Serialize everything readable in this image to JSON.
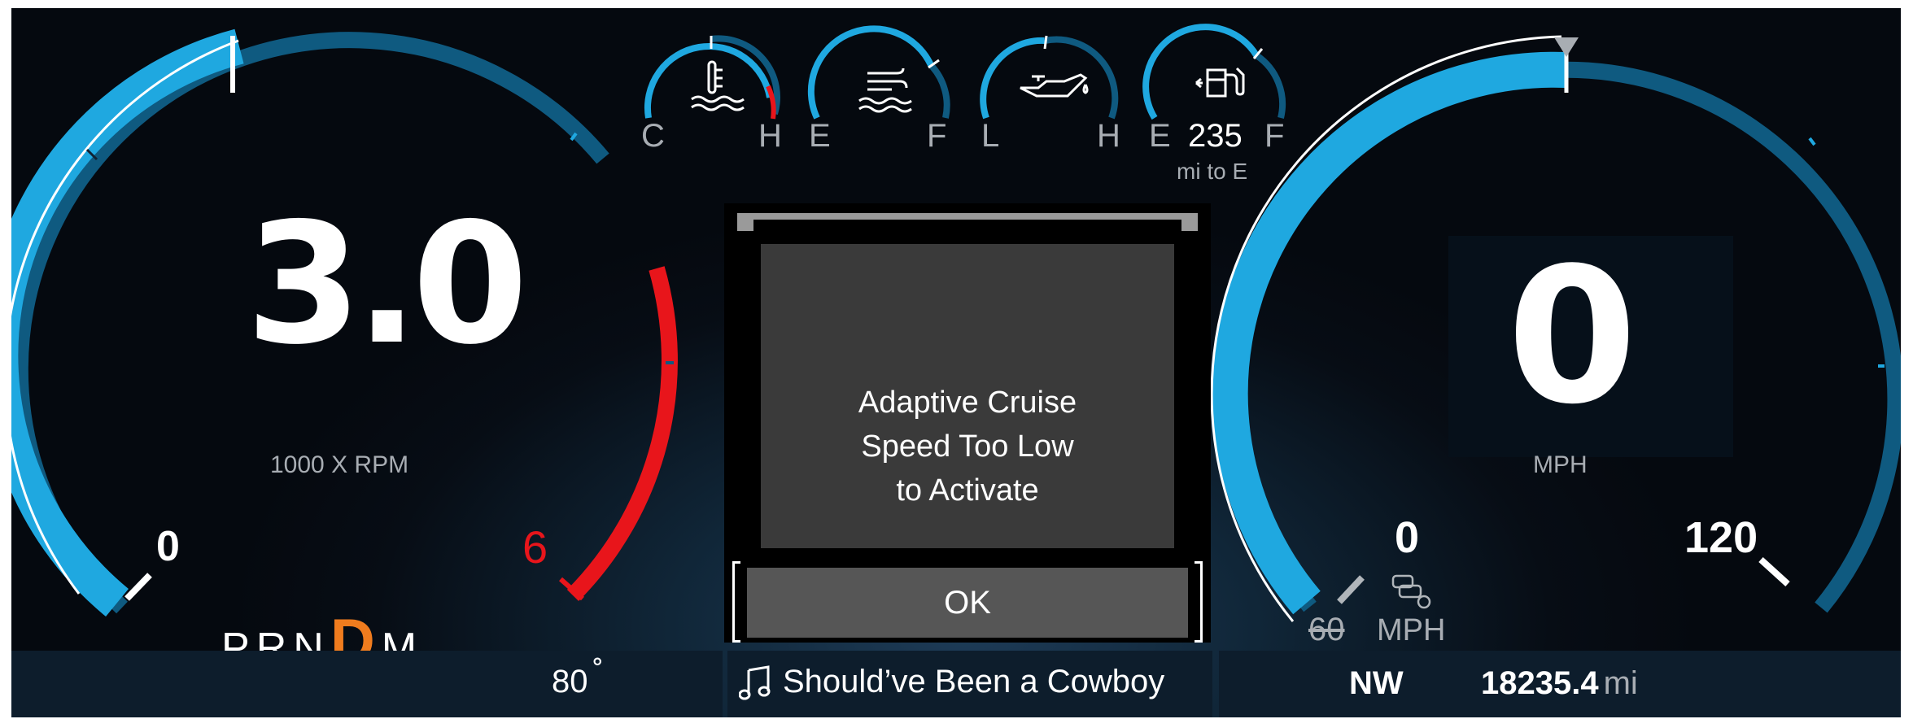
{
  "tachometer": {
    "value": "3.0",
    "unit_label": "1000 X RPM",
    "min_label": "0",
    "redline_label": "6",
    "rpm_thousands": 3.0
  },
  "gear_selector": {
    "gears": [
      "P",
      "R",
      "N",
      "D",
      "M"
    ],
    "selected": "D"
  },
  "mini_gauges": {
    "coolant": {
      "left": "C",
      "right": "H",
      "icon": "coolant-temp-icon"
    },
    "trans": {
      "left": "E",
      "right": "F",
      "icon": "trans-temp-icon"
    },
    "oil": {
      "left": "L",
      "right": "H",
      "icon": "oil-pressure-icon"
    },
    "fuel": {
      "left": "E",
      "right": "F",
      "icon": "fuel-pump-icon",
      "range_value": "235",
      "range_unit": "mi to E"
    }
  },
  "dialog": {
    "message_line1": "Adaptive Cruise",
    "message_line2": "Speed Too Low",
    "message_line3": "to Activate",
    "ok_label": "OK"
  },
  "speedometer": {
    "value": "0",
    "unit_label": "MPH",
    "min_label": "0",
    "max_label": "120",
    "set_speed": "60",
    "set_speed_unit": "MPH"
  },
  "bottom_bar": {
    "outside_temp": "80",
    "temp_unit": "˚",
    "song_title": "Should’ve Been a Cowboy",
    "compass": "NW",
    "odometer": "18235.4",
    "odometer_unit": "mi"
  },
  "colors": {
    "gauge_blue": "#1fa8e0",
    "gauge_dark_blue": "#0f5a80",
    "redline": "#e8151b",
    "gear_highlight": "#f07c1e",
    "dialog_bg": "#3a3a3a"
  }
}
